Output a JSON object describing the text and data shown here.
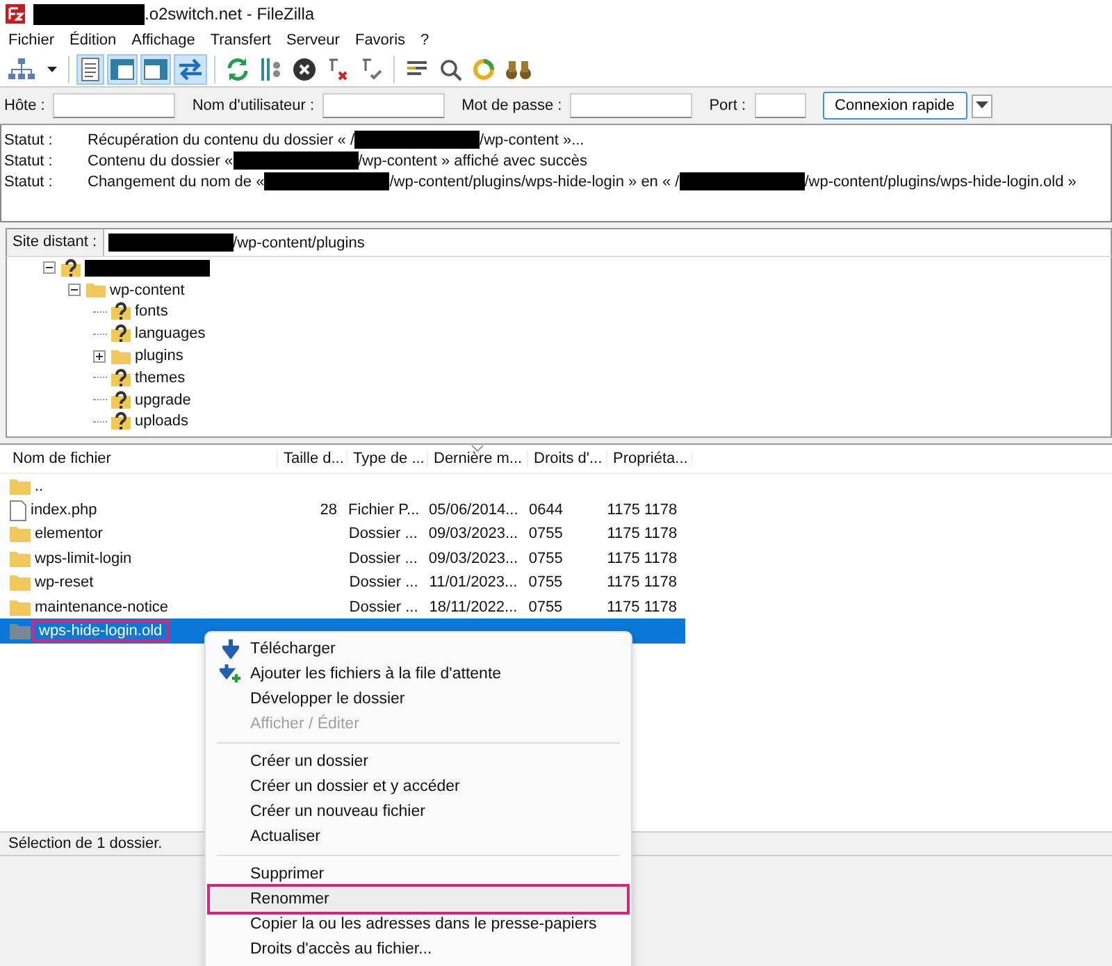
{
  "window": {
    "title_parts": [
      {
        "kind": "redacted"
      },
      {
        "kind": "text",
        "text": ".o2switch.net - FileZilla"
      }
    ]
  },
  "menu": [
    "Fichier",
    "Édition",
    "Affichage",
    "Transfert",
    "Serveur",
    "Favoris",
    "?"
  ],
  "toolbar": [
    {
      "kind": "site-manager",
      "on": false
    },
    {
      "kind": "caret",
      "on": false
    },
    {
      "kind": "sep"
    },
    {
      "kind": "log",
      "on": true
    },
    {
      "kind": "local-tree",
      "on": true
    },
    {
      "kind": "remote-tree",
      "on": true
    },
    {
      "kind": "queue",
      "on": true
    },
    {
      "kind": "sep"
    },
    {
      "kind": "refresh",
      "on": false
    },
    {
      "kind": "filters",
      "on": false
    },
    {
      "kind": "cancel",
      "on": false
    },
    {
      "kind": "disconnect",
      "on": false
    },
    {
      "kind": "reconnect",
      "on": false
    },
    {
      "kind": "sep"
    },
    {
      "kind": "list",
      "on": false
    },
    {
      "kind": "find",
      "on": false
    },
    {
      "kind": "sync",
      "on": false
    },
    {
      "kind": "binoculars",
      "on": false
    }
  ],
  "quickconnect": {
    "fields": [
      {
        "label": "Hôte :"
      },
      {
        "label": "Nom d'utilisateur :"
      },
      {
        "label": "Mot de passe :"
      },
      {
        "label": "Port :"
      }
    ],
    "button": "Connexion rapide"
  },
  "log": [
    {
      "label": "Statut :",
      "parts": [
        {
          "kind": "text",
          "text": "Récupération du contenu du dossier « /"
        },
        {
          "kind": "redacted"
        },
        {
          "kind": "text",
          "text": "/wp-content »..."
        }
      ]
    },
    {
      "label": "Statut :",
      "parts": [
        {
          "kind": "text",
          "text": "Contenu du dossier « "
        },
        {
          "kind": "redacted"
        },
        {
          "kind": "text",
          "text": "/wp-content » affiché avec succès"
        }
      ]
    },
    {
      "label": "Statut :",
      "parts": [
        {
          "kind": "text",
          "text": "Changement du nom de « "
        },
        {
          "kind": "redacted"
        },
        {
          "kind": "text",
          "text": "/wp-content/plugins/wps-hide-login » en « /"
        },
        {
          "kind": "redacted"
        },
        {
          "kind": "text",
          "text": "/wp-content/plugins/wps-hide-login.old »"
        }
      ]
    }
  ],
  "remote_site": {
    "label": "Site distant :",
    "path_parts": [
      {
        "kind": "redacted"
      },
      {
        "kind": "text",
        "text": "/wp-content/plugins"
      }
    ]
  },
  "tree": [
    {
      "kind": "unknown",
      "expanded": true,
      "children": [
        {
          "name": "wp-content",
          "kind": "folder",
          "expanded": true,
          "children": [
            {
              "name": "fonts",
              "kind": "unknown"
            },
            {
              "name": "languages",
              "kind": "unknown"
            },
            {
              "name": "plugins",
              "kind": "folder",
              "expanded": false
            },
            {
              "name": "themes",
              "kind": "unknown"
            },
            {
              "name": "upgrade",
              "kind": "unknown"
            },
            {
              "name": "uploads",
              "kind": "unknown"
            }
          ]
        }
      ]
    }
  ],
  "files": {
    "columns": [
      "Nom de fichier",
      "Taille d...",
      "Type de ...",
      "Dernière m...",
      "Droits d'...",
      "Propriéta..."
    ],
    "rows": [
      {
        "kind": "folder",
        "cells": [
          "..",
          "",
          "",
          "",
          "",
          ""
        ],
        "selected": false,
        "highlighted": false
      },
      {
        "kind": "file",
        "cells": [
          "index.php",
          "28",
          "Fichier P...",
          "05/06/2014...",
          "0644",
          "1175 1178"
        ],
        "selected": false,
        "highlighted": false
      },
      {
        "kind": "folder",
        "cells": [
          "elementor",
          "",
          "Dossier ...",
          "09/03/2023...",
          "0755",
          "1175 1178"
        ],
        "selected": false,
        "highlighted": false
      },
      {
        "kind": "folder",
        "cells": [
          "wps-limit-login",
          "",
          "Dossier ...",
          "09/03/2023...",
          "0755",
          "1175 1178"
        ],
        "selected": false,
        "highlighted": false
      },
      {
        "kind": "folder",
        "cells": [
          "wp-reset",
          "",
          "Dossier ...",
          "11/01/2023...",
          "0755",
          "1175 1178"
        ],
        "selected": false,
        "highlighted": false
      },
      {
        "kind": "folder",
        "cells": [
          "maintenance-notice",
          "",
          "Dossier ...",
          "18/11/2022...",
          "0755",
          "1175 1178"
        ],
        "selected": false,
        "highlighted": false
      },
      {
        "kind": "folder",
        "cells": [
          "wps-hide-login.old",
          "",
          "",
          "",
          "",
          ""
        ],
        "selected": true,
        "highlighted": true
      }
    ]
  },
  "status_bar": "Sélection de 1 dossier.",
  "context_menu": [
    {
      "kind": "download",
      "label": "Télécharger",
      "disabled": false,
      "highlighted": false
    },
    {
      "kind": "queue-add",
      "label": "Ajouter les fichiers à la file d'attente",
      "disabled": false,
      "highlighted": false
    },
    {
      "kind": "item",
      "label": "Développer le dossier",
      "disabled": false,
      "highlighted": false
    },
    {
      "kind": "item",
      "label": "Afficher / Éditer",
      "disabled": true,
      "highlighted": false
    },
    {
      "kind": "separator"
    },
    {
      "kind": "item",
      "label": "Créer un dossier",
      "disabled": false,
      "highlighted": false
    },
    {
      "kind": "item",
      "label": "Créer un dossier et y accéder",
      "disabled": false,
      "highlighted": false
    },
    {
      "kind": "item",
      "label": "Créer un nouveau fichier",
      "disabled": false,
      "highlighted": false
    },
    {
      "kind": "item",
      "label": "Actualiser",
      "disabled": false,
      "highlighted": false
    },
    {
      "kind": "separator"
    },
    {
      "kind": "item",
      "label": "Supprimer",
      "disabled": false,
      "highlighted": false
    },
    {
      "kind": "item",
      "label": "Renommer",
      "disabled": false,
      "highlighted": true
    },
    {
      "kind": "item",
      "label": "Copier la ou les adresses dans le presse-papiers",
      "disabled": false,
      "highlighted": false
    },
    {
      "kind": "item",
      "label": "Droits d'accès au fichier...",
      "disabled": false,
      "highlighted": false
    }
  ]
}
